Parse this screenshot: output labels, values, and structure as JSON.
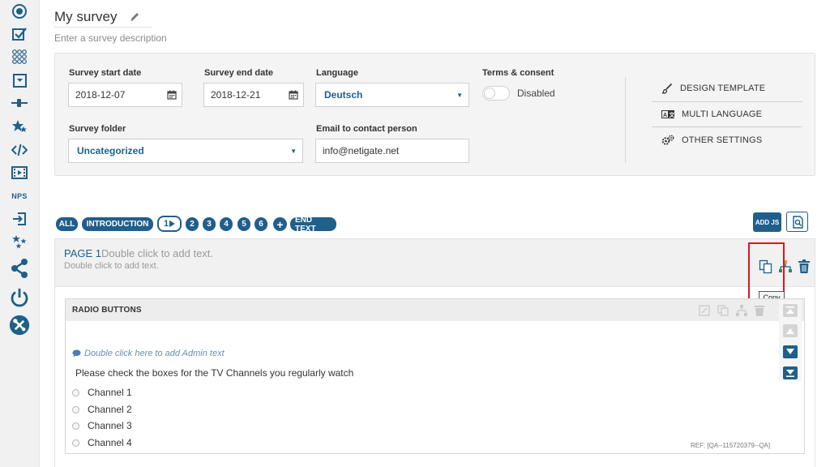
{
  "survey": {
    "title": "My survey",
    "description_placeholder": "Enter a survey description"
  },
  "settings": {
    "start_date_label": "Survey start date",
    "start_date": "2018-12-07",
    "end_date_label": "Survey end date",
    "end_date": "2018-12-21",
    "language_label": "Language",
    "language": "Deutsch",
    "terms_label": "Terms & consent",
    "terms_state": "Disabled",
    "folder_label": "Survey folder",
    "folder": "Uncategorized",
    "email_label": "Email to contact person",
    "email": "info@netigate.net"
  },
  "side_menu": [
    {
      "label": "DESIGN TEMPLATE",
      "icon": "brush-icon"
    },
    {
      "label": "MULTI LANGUAGE",
      "icon": "language-icon"
    },
    {
      "label": "OTHER SETTINGS",
      "icon": "gears-icon"
    }
  ],
  "page_nav": {
    "all": "ALL",
    "introduction": "INTRODUCTION",
    "pages": [
      "1",
      "2",
      "3",
      "4",
      "5",
      "6"
    ],
    "active_page": "1",
    "end_text": "END TEXT",
    "add_js": "ADD JS"
  },
  "page": {
    "title": "PAGE 1",
    "title_hint": "Double click to add text.",
    "subtitle_hint": "Double click to add text.",
    "tooltip": "Copy"
  },
  "question": {
    "type": "RADIO BUTTONS",
    "admin_hint": "Double click here to add Admin text",
    "text": "Please check the boxes for the TV Channels you regularly watch",
    "options": [
      "Channel 1",
      "Channel 2",
      "Channel 3",
      "Channel 4"
    ],
    "ref": "REF: [QA--115720379--QA]"
  },
  "sidebar_icons": [
    "radio-icon",
    "checkbox-icon",
    "matrix-icon",
    "dropdown-icon",
    "slider-icon",
    "rating-icon",
    "code-icon",
    "media-icon",
    "nps-label",
    "import-icon",
    "stars-icon",
    "share-icon",
    "power-icon",
    "tools-icon"
  ],
  "sidebar_nps": "NPS",
  "colors": {
    "accent": "#1f5f8b",
    "highlight": "#e0151b"
  }
}
